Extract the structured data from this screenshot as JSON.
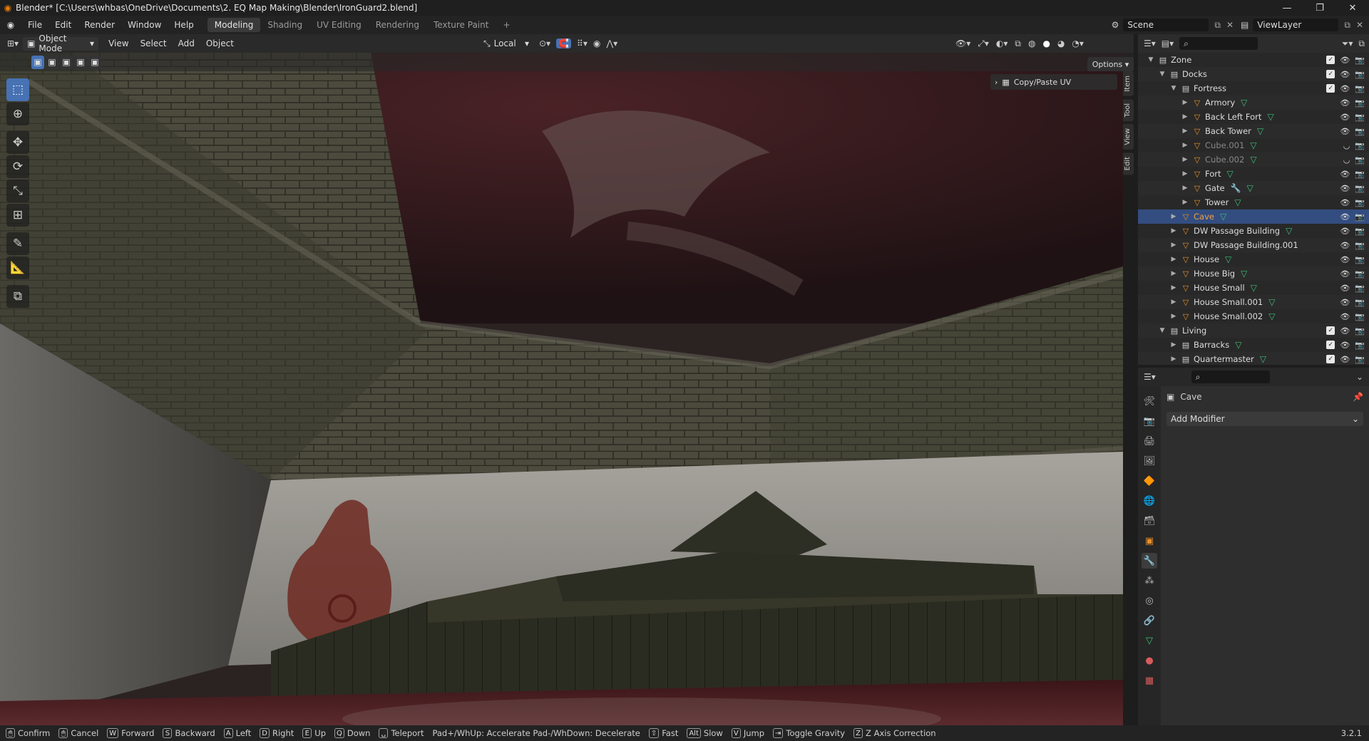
{
  "window": {
    "title": "Blender* [C:\\Users\\whbas\\OneDrive\\Documents\\2. EQ Map Making\\Blender\\IronGuard2.blend]",
    "controls": [
      "minimize-icon",
      "maximize-icon",
      "close-icon"
    ]
  },
  "menu": [
    "File",
    "Edit",
    "Render",
    "Window",
    "Help"
  ],
  "workspaces": [
    {
      "label": "Modeling",
      "active": true
    },
    {
      "label": "Shading",
      "active": false
    },
    {
      "label": "UV Editing",
      "active": false
    },
    {
      "label": "Rendering",
      "active": false
    },
    {
      "label": "Texture Paint",
      "active": false
    }
  ],
  "add_workspace": "+",
  "scene": {
    "name": "Scene",
    "view_layer": "ViewLayer"
  },
  "viewport_header": {
    "mode": "Object Mode",
    "menus": [
      "View",
      "Select",
      "Add",
      "Object"
    ],
    "transform_orientation": "Local",
    "options_label": "Options"
  },
  "sidebar_tabs": [
    "Item",
    "Tool",
    "View",
    "Edit"
  ],
  "panel": {
    "copy_paste_uv": "Copy/Paste UV"
  },
  "outliner": {
    "rows": [
      {
        "label": "Zone",
        "depth": 1,
        "kind": "collection",
        "expanded": true,
        "check": true
      },
      {
        "label": "Docks",
        "depth": 2,
        "kind": "collection",
        "expanded": true,
        "check": true
      },
      {
        "label": "Fortress",
        "depth": 3,
        "kind": "collection",
        "expanded": true,
        "check": true
      },
      {
        "label": "Armory",
        "depth": 4,
        "kind": "object",
        "mesh": true
      },
      {
        "label": "Back Left Fort",
        "depth": 4,
        "kind": "object",
        "mesh": true
      },
      {
        "label": "Back Tower",
        "depth": 4,
        "kind": "object",
        "mesh": true
      },
      {
        "label": "Cube.001",
        "depth": 4,
        "kind": "object",
        "mesh": true,
        "dim": true
      },
      {
        "label": "Cube.002",
        "depth": 4,
        "kind": "object",
        "mesh": true,
        "dim": true
      },
      {
        "label": "Fort",
        "depth": 4,
        "kind": "object",
        "mesh": true
      },
      {
        "label": "Gate",
        "depth": 4,
        "kind": "object",
        "mesh": true,
        "wrench": true
      },
      {
        "label": "Tower",
        "depth": 4,
        "kind": "object",
        "mesh": true
      },
      {
        "label": "Cave",
        "depth": 3,
        "kind": "object",
        "mesh": true,
        "selected": true
      },
      {
        "label": "DW Passage Building",
        "depth": 3,
        "kind": "object",
        "mesh": true
      },
      {
        "label": "DW Passage Building.001",
        "depth": 3,
        "kind": "object"
      },
      {
        "label": "House",
        "depth": 3,
        "kind": "object",
        "mesh": true
      },
      {
        "label": "House Big",
        "depth": 3,
        "kind": "object",
        "mesh": true
      },
      {
        "label": "House Small",
        "depth": 3,
        "kind": "object",
        "mesh": true
      },
      {
        "label": "House Small.001",
        "depth": 3,
        "kind": "object",
        "mesh": true
      },
      {
        "label": "House Small.002",
        "depth": 3,
        "kind": "object",
        "mesh": true
      },
      {
        "label": "Living",
        "depth": 2,
        "kind": "collection",
        "expanded": true,
        "check": true
      },
      {
        "label": "Barracks",
        "depth": 3,
        "kind": "collection",
        "check": true,
        "mesh": true
      },
      {
        "label": "Quartermaster",
        "depth": 3,
        "kind": "collection",
        "check": true,
        "mesh": true
      }
    ]
  },
  "properties": {
    "object_name": "Cave",
    "add_modifier": "Add Modifier"
  },
  "status": {
    "items": [
      {
        "key": "🖱",
        "label": "Confirm"
      },
      {
        "key": "🖱",
        "label": "Cancel"
      },
      {
        "key": "W",
        "label": "Forward"
      },
      {
        "key": "S",
        "label": "Backward"
      },
      {
        "key": "A",
        "label": "Left"
      },
      {
        "key": "D",
        "label": "Right"
      },
      {
        "key": "E",
        "label": "Up"
      },
      {
        "key": "Q",
        "label": "Down"
      },
      {
        "key": "␣",
        "label": "Teleport"
      },
      {
        "key": "",
        "label": "Pad+/WhUp: Accelerate Pad-/WhDown: Decelerate"
      },
      {
        "key": "⇧",
        "label": "Fast"
      },
      {
        "key": "Alt",
        "label": "Slow"
      },
      {
        "key": "V",
        "label": "Jump"
      },
      {
        "key": "⇥",
        "label": "Toggle Gravity"
      },
      {
        "key": "Z",
        "label": "Z Axis Correction"
      }
    ],
    "version": "3.2.1"
  },
  "colors": {
    "selection": "#334d80",
    "accent": "#4772b3",
    "object_orange": "#e8902c",
    "mesh_green": "#3fbf78"
  }
}
